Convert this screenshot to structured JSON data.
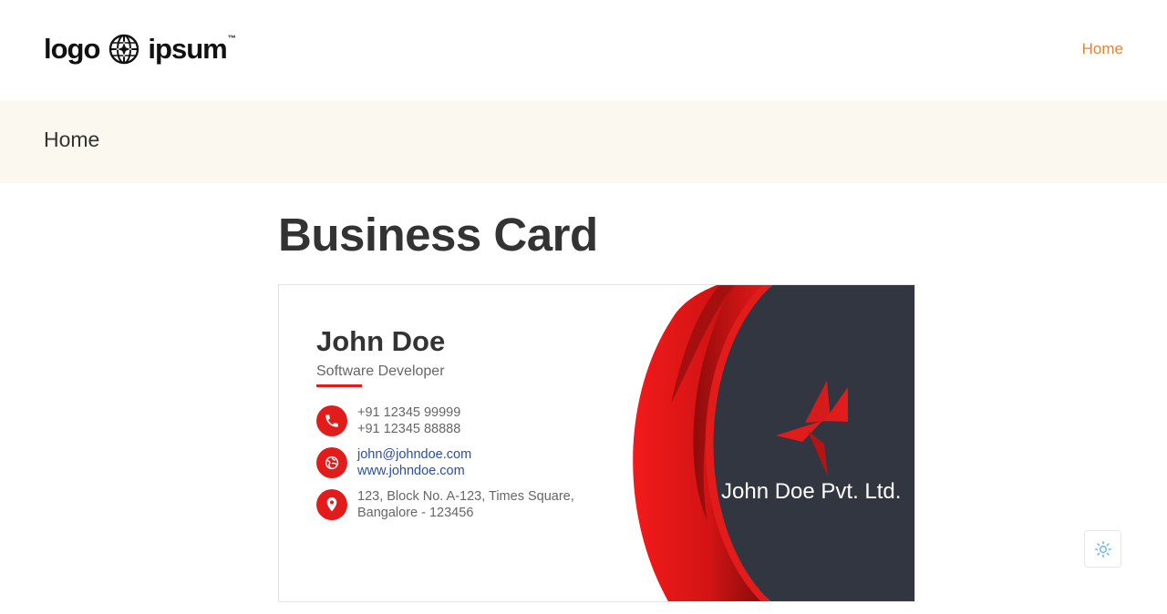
{
  "header": {
    "logo_left": "logo",
    "logo_right": "ipsum",
    "logo_tm": "™",
    "nav_home": "Home",
    "nav_color": "#e8823a"
  },
  "banner": {
    "title": "Home",
    "background": "#fbf8f0"
  },
  "main": {
    "title": "Business Card"
  },
  "card": {
    "name": "John Doe",
    "role": "Software Developer",
    "accent_color": "#e21b1b",
    "panel_color": "#323641",
    "phone": {
      "icon": "phone-icon",
      "line1": "+91 12345 99999",
      "line2": "+91 12345 88888"
    },
    "web": {
      "icon": "globe-icon",
      "email": "john@johndoe.com",
      "website": "www.johndoe.com"
    },
    "address": {
      "icon": "location-pin-icon",
      "line1": "123, Block No. A-123, Times Square,",
      "line2": "Bangalore - 123456"
    },
    "company": "John Doe Pvt. Ltd.",
    "company_logo": "pinwheel-logo-icon"
  },
  "theme_toggle": {
    "icon": "sun-icon"
  }
}
